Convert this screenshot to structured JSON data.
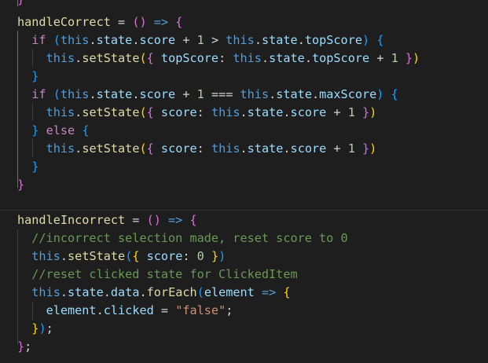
{
  "editor": {
    "theme": "dark",
    "colors": {
      "background": "#1e1e1e",
      "keyword": "#c586c0",
      "this_keyword": "#569cd6",
      "function": "#dcdcaa",
      "property": "#9cdcfe",
      "number": "#b5cea8",
      "string": "#ce9178",
      "comment": "#6a9955",
      "bracket_gold": "#ffd700",
      "bracket_orchid": "#da70d6",
      "bracket_blue": "#179fff"
    },
    "code": {
      "l1": [
        {
          "text": "}",
          "cls": "b2"
        }
      ],
      "l2": [
        {
          "text": "handleCorrect",
          "cls": "f"
        },
        {
          "text": " = ",
          "cls": "o"
        },
        {
          "text": "()",
          "cls": "b2"
        },
        {
          "text": " => ",
          "cls": "t"
        },
        {
          "text": "{",
          "cls": "b2"
        }
      ],
      "l3": [
        {
          "text": "  if ",
          "cls": "k"
        },
        {
          "text": "(",
          "cls": "b3"
        },
        {
          "text": "this",
          "cls": "t"
        },
        {
          "text": ".",
          "cls": "o"
        },
        {
          "text": "state",
          "cls": "p"
        },
        {
          "text": ".",
          "cls": "o"
        },
        {
          "text": "score",
          "cls": "p"
        },
        {
          "text": " + ",
          "cls": "o"
        },
        {
          "text": "1",
          "cls": "n"
        },
        {
          "text": " > ",
          "cls": "o"
        },
        {
          "text": "this",
          "cls": "t"
        },
        {
          "text": ".",
          "cls": "o"
        },
        {
          "text": "state",
          "cls": "p"
        },
        {
          "text": ".",
          "cls": "o"
        },
        {
          "text": "topScore",
          "cls": "p"
        },
        {
          "text": ")",
          "cls": "b3"
        },
        {
          "text": " ",
          "cls": "o"
        },
        {
          "text": "{",
          "cls": "b3"
        }
      ],
      "l4": [
        {
          "text": "    this",
          "cls": "t"
        },
        {
          "text": ".",
          "cls": "o"
        },
        {
          "text": "setState",
          "cls": "f"
        },
        {
          "text": "(",
          "cls": "b1"
        },
        {
          "text": "{ ",
          "cls": "b2"
        },
        {
          "text": "topScore",
          "cls": "p"
        },
        {
          "text": ": ",
          "cls": "o"
        },
        {
          "text": "this",
          "cls": "t"
        },
        {
          "text": ".",
          "cls": "o"
        },
        {
          "text": "state",
          "cls": "p"
        },
        {
          "text": ".",
          "cls": "o"
        },
        {
          "text": "topScore",
          "cls": "p"
        },
        {
          "text": " + ",
          "cls": "o"
        },
        {
          "text": "1",
          "cls": "n"
        },
        {
          "text": " }",
          "cls": "b2"
        },
        {
          "text": ")",
          "cls": "b1"
        }
      ],
      "l5": [
        {
          "text": "  }",
          "cls": "b3"
        }
      ],
      "l6": [
        {
          "text": "  if ",
          "cls": "k"
        },
        {
          "text": "(",
          "cls": "b3"
        },
        {
          "text": "this",
          "cls": "t"
        },
        {
          "text": ".",
          "cls": "o"
        },
        {
          "text": "state",
          "cls": "p"
        },
        {
          "text": ".",
          "cls": "o"
        },
        {
          "text": "score",
          "cls": "p"
        },
        {
          "text": " + ",
          "cls": "o"
        },
        {
          "text": "1",
          "cls": "n"
        },
        {
          "text": " === ",
          "cls": "o"
        },
        {
          "text": "this",
          "cls": "t"
        },
        {
          "text": ".",
          "cls": "o"
        },
        {
          "text": "state",
          "cls": "p"
        },
        {
          "text": ".",
          "cls": "o"
        },
        {
          "text": "maxScore",
          "cls": "p"
        },
        {
          "text": ")",
          "cls": "b3"
        },
        {
          "text": " ",
          "cls": "o"
        },
        {
          "text": "{",
          "cls": "b3"
        }
      ],
      "l7": [
        {
          "text": "    this",
          "cls": "t"
        },
        {
          "text": ".",
          "cls": "o"
        },
        {
          "text": "setState",
          "cls": "f"
        },
        {
          "text": "(",
          "cls": "b1"
        },
        {
          "text": "{ ",
          "cls": "b2"
        },
        {
          "text": "score",
          "cls": "p"
        },
        {
          "text": ": ",
          "cls": "o"
        },
        {
          "text": "this",
          "cls": "t"
        },
        {
          "text": ".",
          "cls": "o"
        },
        {
          "text": "state",
          "cls": "p"
        },
        {
          "text": ".",
          "cls": "o"
        },
        {
          "text": "score",
          "cls": "p"
        },
        {
          "text": " + ",
          "cls": "o"
        },
        {
          "text": "1",
          "cls": "n"
        },
        {
          "text": " }",
          "cls": "b2"
        },
        {
          "text": ")",
          "cls": "b1"
        }
      ],
      "l8": [
        {
          "text": "  }",
          "cls": "b3"
        },
        {
          "text": " else ",
          "cls": "k"
        },
        {
          "text": "{",
          "cls": "b3"
        }
      ],
      "l9": [
        {
          "text": "    this",
          "cls": "t"
        },
        {
          "text": ".",
          "cls": "o"
        },
        {
          "text": "setState",
          "cls": "f"
        },
        {
          "text": "(",
          "cls": "b1"
        },
        {
          "text": "{ ",
          "cls": "b2"
        },
        {
          "text": "score",
          "cls": "p"
        },
        {
          "text": ": ",
          "cls": "o"
        },
        {
          "text": "this",
          "cls": "t"
        },
        {
          "text": ".",
          "cls": "o"
        },
        {
          "text": "state",
          "cls": "p"
        },
        {
          "text": ".",
          "cls": "o"
        },
        {
          "text": "score",
          "cls": "p"
        },
        {
          "text": " + ",
          "cls": "o"
        },
        {
          "text": "1",
          "cls": "n"
        },
        {
          "text": " }",
          "cls": "b2"
        },
        {
          "text": ")",
          "cls": "b1"
        }
      ],
      "l10": [
        {
          "text": "  }",
          "cls": "b3"
        }
      ],
      "l11": [
        {
          "text": "}",
          "cls": "b2"
        }
      ],
      "l12": [
        {
          "text": "handleIncorrect",
          "cls": "f"
        },
        {
          "text": " = ",
          "cls": "o"
        },
        {
          "text": "()",
          "cls": "b2"
        },
        {
          "text": " => ",
          "cls": "t"
        },
        {
          "text": "{",
          "cls": "b2"
        }
      ],
      "l13": [
        {
          "text": "  //incorrect selection made, reset score to 0",
          "cls": "c"
        }
      ],
      "l14": [
        {
          "text": "  this",
          "cls": "t"
        },
        {
          "text": ".",
          "cls": "o"
        },
        {
          "text": "setState",
          "cls": "f"
        },
        {
          "text": "(",
          "cls": "b3"
        },
        {
          "text": "{ ",
          "cls": "b1"
        },
        {
          "text": "score",
          "cls": "p"
        },
        {
          "text": ": ",
          "cls": "o"
        },
        {
          "text": "0",
          "cls": "n"
        },
        {
          "text": " }",
          "cls": "b1"
        },
        {
          "text": ")",
          "cls": "b3"
        }
      ],
      "l15": [
        {
          "text": "  //reset clicked state for ClickedItem",
          "cls": "c"
        }
      ],
      "l16": [
        {
          "text": "  this",
          "cls": "t"
        },
        {
          "text": ".",
          "cls": "o"
        },
        {
          "text": "state",
          "cls": "p"
        },
        {
          "text": ".",
          "cls": "o"
        },
        {
          "text": "data",
          "cls": "p"
        },
        {
          "text": ".",
          "cls": "o"
        },
        {
          "text": "forEach",
          "cls": "f"
        },
        {
          "text": "(",
          "cls": "b3"
        },
        {
          "text": "element",
          "cls": "p"
        },
        {
          "text": " => ",
          "cls": "t"
        },
        {
          "text": "{",
          "cls": "b1"
        }
      ],
      "l17": [
        {
          "text": "    element",
          "cls": "p"
        },
        {
          "text": ".",
          "cls": "o"
        },
        {
          "text": "clicked",
          "cls": "p"
        },
        {
          "text": " = ",
          "cls": "o"
        },
        {
          "text": "\"false\"",
          "cls": "s"
        },
        {
          "text": ";",
          "cls": "o"
        }
      ],
      "l18": [
        {
          "text": "  }",
          "cls": "b1"
        },
        {
          "text": ")",
          "cls": "b3"
        },
        {
          "text": ";",
          "cls": "o"
        }
      ],
      "l19": [
        {
          "text": "}",
          "cls": "b2"
        },
        {
          "text": ";",
          "cls": "o"
        }
      ]
    }
  }
}
